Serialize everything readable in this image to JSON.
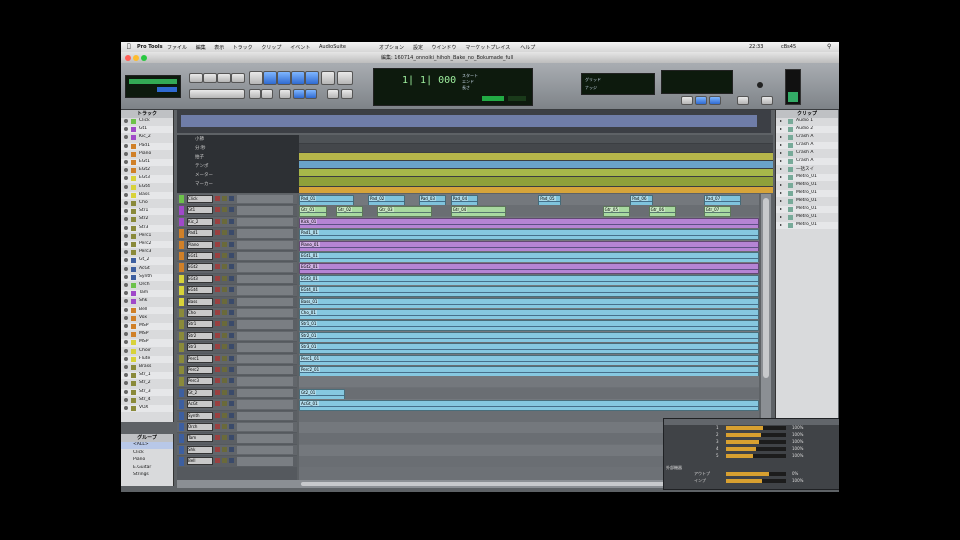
{
  "menubar": {
    "app": "Pro Tools",
    "items": [
      "ファイル",
      "編集",
      "表示",
      "トラック",
      "クリップ",
      "イベント",
      "AudioSuite",
      "オプション",
      "設定",
      "ウインドウ",
      "マーケットプレイス",
      "ヘルプ"
    ],
    "clock": "22:33",
    "status_right": "cBs45"
  },
  "window": {
    "title": "編集: 160714_onnoiki_hihoh_Bake_no_Bokumade_full"
  },
  "counters": {
    "main": "1| 1| 000",
    "pre": "0",
    "post": "0",
    "start_label": "スタート",
    "end_label": "エンド",
    "length_label": "長さ"
  },
  "edit_tools": {
    "grid": "グリッド",
    "nudge": "ナッジ"
  },
  "track_list": {
    "header": "トラック",
    "items": [
      "Click",
      "Gt1",
      "Kic_2",
      "Pad1",
      "Piano",
      "EGt1",
      "EGt2",
      "EGt3",
      "EGt4",
      "Bass",
      "Cho",
      "Str1",
      "Str2",
      "Str3",
      "Perc1",
      "Perc2",
      "Perc3",
      "Gt_2",
      "AcGt",
      "Synth",
      "Orch",
      "Tam",
      "Shk",
      "Bell",
      "Vox",
      "MSP",
      "MSP",
      "MSP",
      "Choir",
      "Flute",
      "Brass",
      "Str_1",
      "Str_2",
      "Str_3",
      "Str_4",
      "VOX"
    ],
    "groups_header": "グループ",
    "groups": [
      "<ALL>",
      "Click",
      "Piano",
      "E.Guitar",
      "Strings"
    ]
  },
  "rulers": {
    "labels": [
      "小節",
      "分:秒",
      "拍子",
      "テンポ",
      "メーター",
      "マーカー"
    ]
  },
  "tracks": [
    {
      "name": "Click",
      "color": "#6dc24a",
      "clips": [
        {
          "s": 0.0,
          "w": 0.12,
          "n": "Pad_01"
        },
        {
          "s": 0.15,
          "w": 0.08,
          "n": "Pad_02"
        },
        {
          "s": 0.26,
          "w": 0.06,
          "n": "Pad_03"
        },
        {
          "s": 0.33,
          "w": 0.06,
          "n": "Pad_04"
        },
        {
          "s": 0.52,
          "w": 0.05,
          "n": "Pad_05"
        },
        {
          "s": 0.72,
          "w": 0.05,
          "n": "Pad_06"
        },
        {
          "s": 0.88,
          "w": 0.08,
          "n": "Pad_07"
        }
      ],
      "clipcolor": "#7fc3dc"
    },
    {
      "name": "Gt1",
      "color": "#a049c9",
      "clips": [
        {
          "s": 0.0,
          "w": 0.06,
          "n": "Gtr_01"
        },
        {
          "s": 0.08,
          "w": 0.06,
          "n": "Gtr_02"
        },
        {
          "s": 0.17,
          "w": 0.12,
          "n": "Gtr_03"
        },
        {
          "s": 0.33,
          "w": 0.12,
          "n": "Gtr_04"
        },
        {
          "s": 0.66,
          "w": 0.06,
          "n": "Gtr_05"
        },
        {
          "s": 0.76,
          "w": 0.06,
          "n": "Gtr_06"
        },
        {
          "s": 0.88,
          "w": 0.06,
          "n": "Gtr_07"
        }
      ],
      "clipcolor": "#a8d9a0"
    },
    {
      "name": "Kic_2",
      "color": "#a049c9",
      "clips": [
        {
          "s": 0.0,
          "w": 1.0,
          "n": "Kick_01"
        }
      ],
      "clipcolor": "#b584d4"
    },
    {
      "name": "Pad1",
      "color": "#d08028",
      "clips": [
        {
          "s": 0.0,
          "w": 1.0,
          "n": "Pad1_01"
        }
      ],
      "clipcolor": "#86c8e0"
    },
    {
      "name": "Piano",
      "color": "#d08028",
      "clips": [
        {
          "s": 0.0,
          "w": 1.0,
          "n": "Piano_01"
        }
      ],
      "clipcolor": "#b584d4"
    },
    {
      "name": "EGt1",
      "color": "#d08028",
      "clips": [
        {
          "s": 0.0,
          "w": 1.0,
          "n": "EGt1_01"
        }
      ],
      "clipcolor": "#86c8e0"
    },
    {
      "name": "EGt2",
      "color": "#d08028",
      "clips": [
        {
          "s": 0.0,
          "w": 1.0,
          "n": "EGt2_01"
        }
      ],
      "clipcolor": "#b584d4"
    },
    {
      "name": "EGt3",
      "color": "#d8d23a",
      "clips": [
        {
          "s": 0.0,
          "w": 1.0,
          "n": "EGt3_01"
        }
      ],
      "clipcolor": "#86c8e0"
    },
    {
      "name": "EGt4",
      "color": "#d8d23a",
      "clips": [
        {
          "s": 0.0,
          "w": 1.0,
          "n": "EGt4_01"
        }
      ],
      "clipcolor": "#86c8e0"
    },
    {
      "name": "Bass",
      "color": "#d8d23a",
      "clips": [
        {
          "s": 0.0,
          "w": 1.0,
          "n": "Bass_01"
        }
      ],
      "clipcolor": "#86c8e0"
    },
    {
      "name": "Cho",
      "color": "#8a8a3a",
      "clips": [
        {
          "s": 0.0,
          "w": 1.0,
          "n": "Cho_01"
        }
      ],
      "clipcolor": "#86c8e0"
    },
    {
      "name": "Str1",
      "color": "#8a8a3a",
      "clips": [
        {
          "s": 0.0,
          "w": 1.0,
          "n": "Str1_01"
        }
      ],
      "clipcolor": "#86c8e0"
    },
    {
      "name": "Str2",
      "color": "#8a8a3a",
      "clips": [
        {
          "s": 0.0,
          "w": 1.0,
          "n": "Str2_01"
        }
      ],
      "clipcolor": "#86c8e0"
    },
    {
      "name": "Str3",
      "color": "#8a8a3a",
      "clips": [
        {
          "s": 0.0,
          "w": 1.0,
          "n": "Str3_01"
        }
      ],
      "clipcolor": "#86c8e0"
    },
    {
      "name": "Perc1",
      "color": "#8a8a3a",
      "clips": [
        {
          "s": 0.0,
          "w": 1.0,
          "n": "Perc1_01"
        }
      ],
      "clipcolor": "#86c8e0"
    },
    {
      "name": "Perc2",
      "color": "#8a8a3a",
      "clips": [
        {
          "s": 0.0,
          "w": 1.0,
          "n": "Perc2_01"
        }
      ],
      "clipcolor": "#86c8e0"
    },
    {
      "name": "Perc3",
      "color": "#8a8a3a",
      "clips": [],
      "clipcolor": "#cfcfcf"
    },
    {
      "name": "Gt_2",
      "color": "#3d5fa0",
      "clips": [
        {
          "s": 0.0,
          "w": 0.1,
          "n": "Gt2_01"
        }
      ],
      "clipcolor": "#86c8e0"
    },
    {
      "name": "AcGt",
      "color": "#3d5fa0",
      "clips": [
        {
          "s": 0.0,
          "w": 1.0,
          "n": "AcGt_01"
        }
      ],
      "clipcolor": "#86c8e0"
    },
    {
      "name": "Synth",
      "color": "#3d5fa0",
      "clips": [],
      "clipcolor": "#cfcfcf"
    },
    {
      "name": "Orch",
      "color": "#3d5fa0",
      "clips": [],
      "clipcolor": "#cfcfcf"
    },
    {
      "name": "Tam",
      "color": "#3d5fa0",
      "clips": [],
      "clipcolor": "#cfcfcf"
    },
    {
      "name": "Shk",
      "color": "#3d5fa0",
      "clips": [],
      "clipcolor": "#cfcfcf"
    },
    {
      "name": "Bell",
      "color": "#3d5fa0",
      "clips": [],
      "clipcolor": "#cfcfcf"
    }
  ],
  "clip_list": {
    "header": "クリップ",
    "items": [
      "Audio 1",
      "Audio 2",
      "Crash A",
      "Crash A",
      "Crash A",
      "Crash A",
      "一括スイ",
      "Metro_01",
      "Metro_01",
      "Metro_01",
      "Metro_01",
      "Metro_01",
      "Metro_01",
      "Metro_01"
    ]
  },
  "mixer_popup": {
    "rows": [
      {
        "label": "1",
        "value": "100%",
        "level": 0.62
      },
      {
        "label": "2",
        "value": "100%",
        "level": 0.58
      },
      {
        "label": "3",
        "value": "100%",
        "level": 0.55
      },
      {
        "label": "4",
        "value": "100%",
        "level": 0.5
      },
      {
        "label": "5",
        "value": "100%",
        "level": 0.45
      }
    ],
    "footer_title": "外部機器",
    "footer_rows": [
      {
        "label": "アウトプ",
        "value": "0%",
        "level": 0.72
      },
      {
        "label": "インプ",
        "value": "100%",
        "level": 0.6
      }
    ]
  },
  "colors": {
    "accent": "#2f6ad0",
    "lcd_text": "#7fe07f"
  }
}
